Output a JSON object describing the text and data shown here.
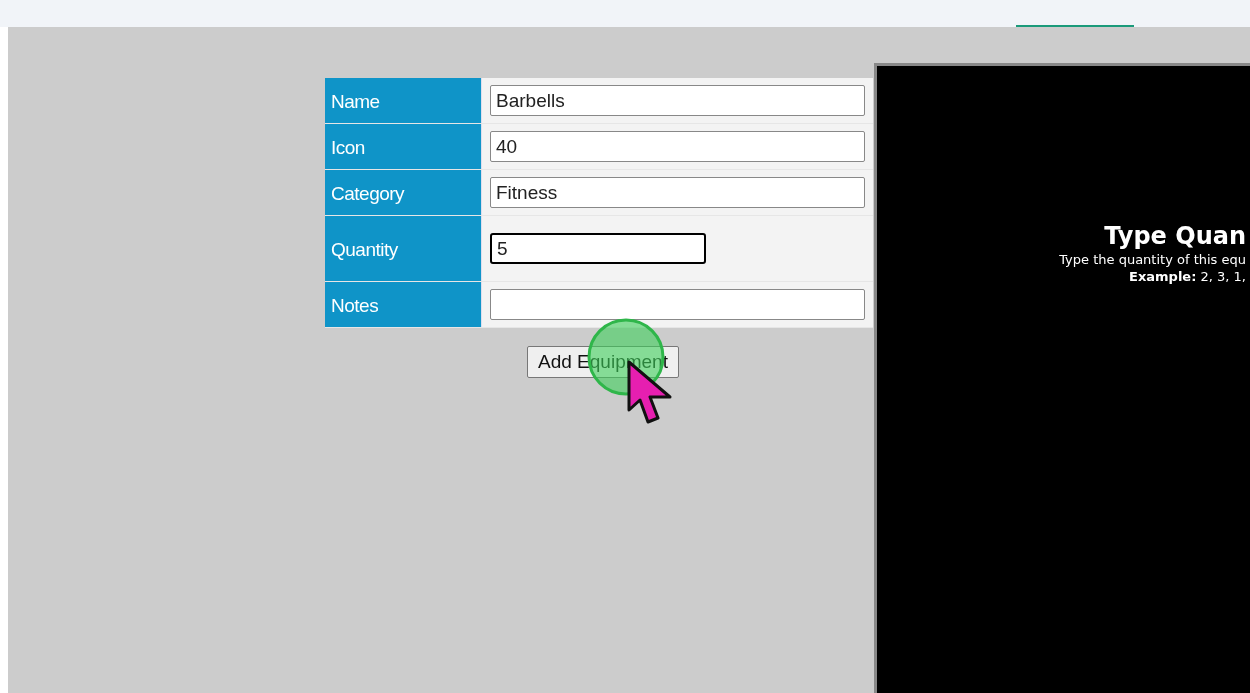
{
  "form": {
    "fields": [
      {
        "label": "Name",
        "value": "Barbells",
        "focused": false
      },
      {
        "label": "Icon",
        "value": "40",
        "focused": false
      },
      {
        "label": "Category",
        "value": "Fitness",
        "focused": false
      },
      {
        "label": "Quantity",
        "value": "5",
        "focused": true
      },
      {
        "label": "Notes",
        "focused": false
      }
    ],
    "submit": "Add Equipment"
  },
  "tip": {
    "title": "Type Quan",
    "text": "Type the quantity of this equ",
    "example": "**Example:** 2, 3, 1,"
  }
}
